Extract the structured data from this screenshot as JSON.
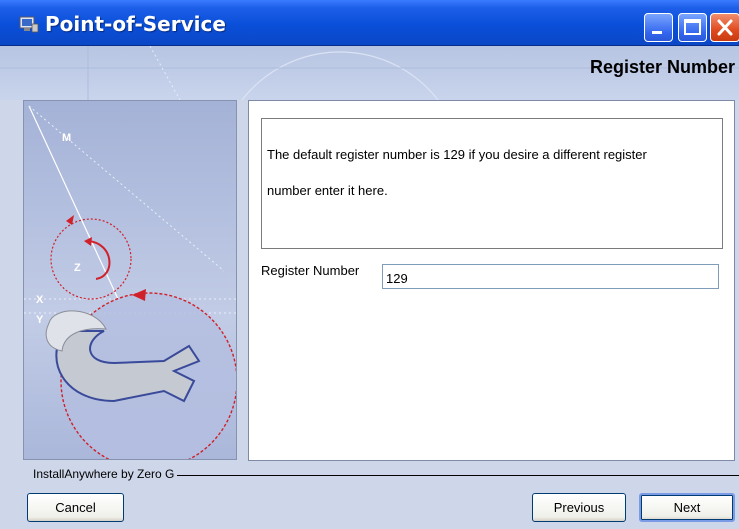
{
  "window": {
    "title": "Point-of-Service"
  },
  "header": {
    "step_title": "Register Number"
  },
  "panel": {
    "description_lines": [
      "The default register number is 129 if you desire a different register",
      "number enter it here."
    ],
    "field_label": "Register Number",
    "field_value": "129"
  },
  "footer": {
    "brand": "InstallAnywhere by Zero G",
    "cancel_label": "Cancel",
    "previous_label": "Previous",
    "next_label": "Next"
  },
  "side_image": {
    "axis_labels": [
      "M",
      "Z",
      "X",
      "Y"
    ]
  },
  "colors": {
    "title_bar": "#0a4fd9",
    "background": "#ced7ea",
    "close_button": "#e04a1f"
  },
  "icons": [
    "app-icon",
    "minimize-icon",
    "maximize-icon",
    "close-icon",
    "wrench-icon"
  ]
}
